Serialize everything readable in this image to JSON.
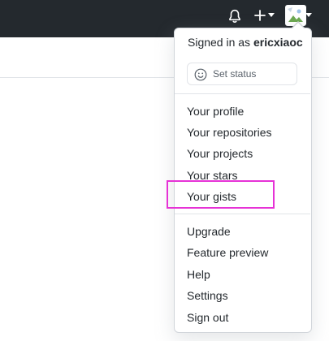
{
  "header": {
    "bell_icon": "bell-icon",
    "plus_icon": "plus-icon",
    "caret_icon": "caret-down-icon",
    "avatar_icon": "avatar-icon"
  },
  "menu": {
    "signed_in_prefix": "Signed in as",
    "username": "ericxiaoc",
    "set_status_label": "Set status",
    "set_status_icon": "smiley-icon",
    "group1": [
      "Your profile",
      "Your repositories",
      "Your projects",
      "Your stars",
      "Your gists"
    ],
    "group2": [
      "Upgrade",
      "Feature preview",
      "Help",
      "Settings",
      "Sign out"
    ]
  },
  "colors": {
    "header_bg": "#24292e",
    "highlight": "#e632d6",
    "text": "#24292e",
    "muted": "#586069"
  }
}
